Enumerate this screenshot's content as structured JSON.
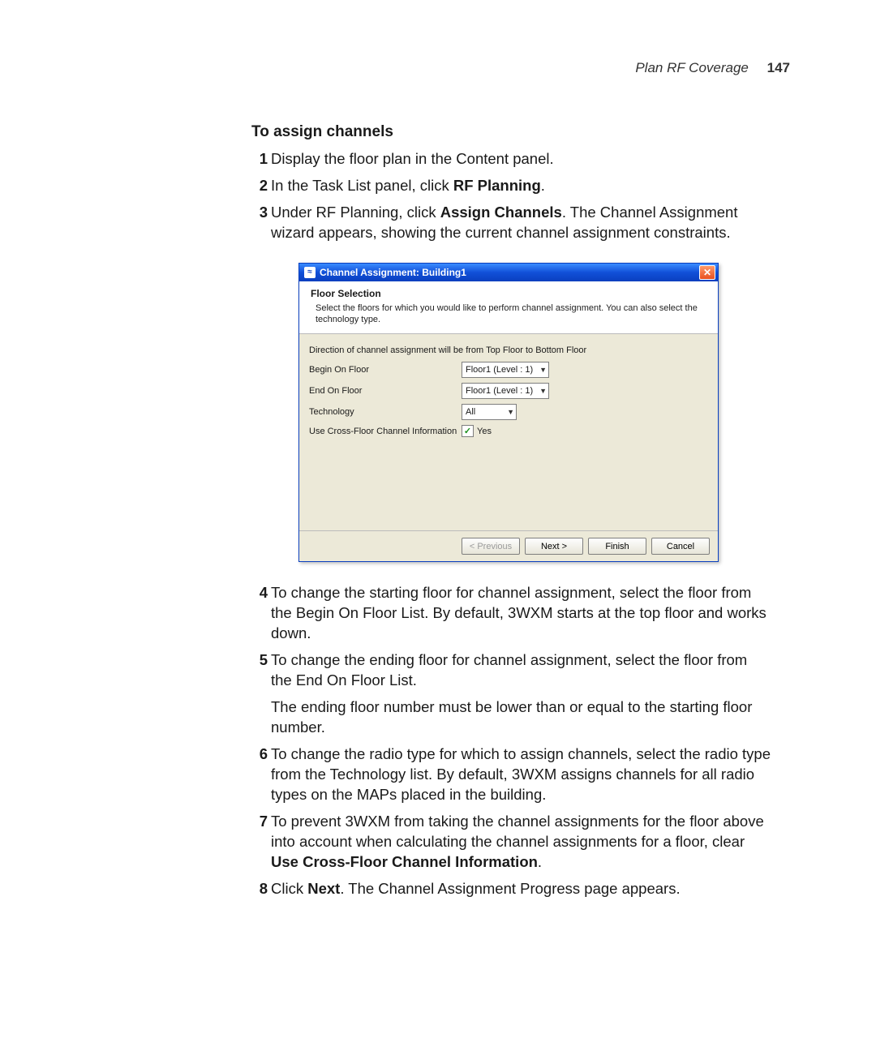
{
  "header": {
    "running_title": "Plan RF Coverage",
    "page_number": "147"
  },
  "section_title": "To assign channels",
  "steps": {
    "s1": "Display the floor plan in the Content panel.",
    "s2_a": "In the Task List panel, click ",
    "s2_b": "RF Planning",
    "s2_c": ".",
    "s3_a": "Under RF Planning, click ",
    "s3_b": "Assign Channels",
    "s3_c": ". The Channel Assignment wizard appears, showing the current channel assignment constraints.",
    "s4": "To change the starting floor for channel assignment, select the floor from the Begin On Floor List. By default, 3WXM starts at the top floor and works down.",
    "s5": "To change the ending floor for channel assignment, select the floor from the End On Floor List.",
    "s5_para": "The ending floor number must be lower than or equal to the starting floor number.",
    "s6": "To change the radio type for which to assign channels, select the radio type from the Technology list. By default, 3WXM assigns channels for all radio types on the MAPs placed in the building.",
    "s7_a": "To prevent 3WXM from taking the channel assignments for the floor above into account when calculating the channel assignments for a floor, clear ",
    "s7_b": "Use Cross-Floor Channel Information",
    "s7_c": ".",
    "s8_a": "Click ",
    "s8_b": "Next",
    "s8_c": ". The Channel Assignment Progress page appears."
  },
  "dialog": {
    "title": "Channel Assignment: Building1",
    "head_title": "Floor Selection",
    "head_desc": "Select the floors for which you would like to perform channel assignment. You can also select the technology type.",
    "direction": "Direction of channel assignment will be from Top Floor to Bottom Floor",
    "labels": {
      "begin": "Begin On Floor",
      "end": "End On Floor",
      "tech": "Technology",
      "cross": "Use Cross-Floor Channel Information"
    },
    "values": {
      "begin": "Floor1 (Level : 1)",
      "end": "Floor1 (Level : 1)",
      "tech": "All",
      "cross_checked": "✓",
      "cross_text": "Yes"
    },
    "buttons": {
      "prev": "< Previous",
      "next": "Next >",
      "finish": "Finish",
      "cancel": "Cancel"
    },
    "close": "✕"
  }
}
